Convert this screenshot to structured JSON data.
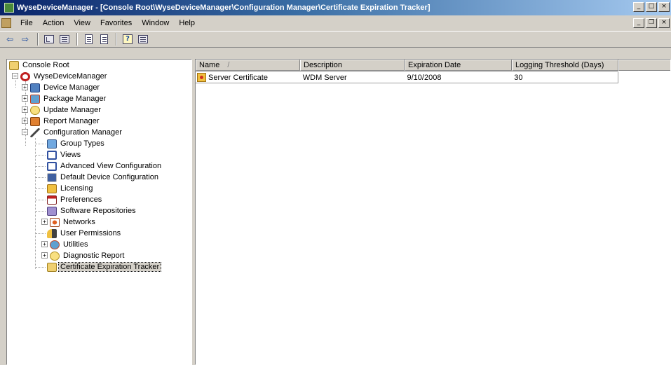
{
  "window": {
    "title": "WyseDeviceManager - [Console Root\\WyseDeviceManager\\Configuration Manager\\Certificate Expiration Tracker]",
    "icon": "wdm-app-icon",
    "controls": {
      "minimize": "_",
      "maximize": "□",
      "close": "×"
    }
  },
  "menubar": {
    "items": [
      "File",
      "Action",
      "View",
      "Favorites",
      "Window",
      "Help"
    ],
    "mdi_controls": {
      "minimize": "_",
      "restore": "❐",
      "close": "×"
    }
  },
  "toolbar": {
    "back": "⇦",
    "forward": "⇨",
    "buttons": [
      "up-one-level",
      "show-hide-tree",
      "list-view",
      "export-list",
      "help",
      "properties"
    ]
  },
  "tree": {
    "items": [
      {
        "label": "Console Root",
        "icon": "folder-icon"
      },
      {
        "label": "WyseDeviceManager",
        "icon": "wdm-icon"
      },
      {
        "label": "Device Manager",
        "icon": "devices-icon"
      },
      {
        "label": "Package Manager",
        "icon": "package-icon"
      },
      {
        "label": "Update Manager",
        "icon": "update-icon"
      },
      {
        "label": "Report Manager",
        "icon": "report-icon"
      },
      {
        "label": "Configuration Manager",
        "icon": "tools-icon"
      },
      {
        "label": "Group Types",
        "icon": "group-icon"
      },
      {
        "label": "Views",
        "icon": "views-icon"
      },
      {
        "label": "Advanced View Configuration",
        "icon": "views-icon"
      },
      {
        "label": "Default Device Configuration",
        "icon": "device-config-icon"
      },
      {
        "label": "Licensing",
        "icon": "license-icon"
      },
      {
        "label": "Preferences",
        "icon": "preferences-icon"
      },
      {
        "label": "Software Repositories",
        "icon": "repository-icon"
      },
      {
        "label": "Networks",
        "icon": "network-icon"
      },
      {
        "label": "User Permissions",
        "icon": "user-permissions-icon"
      },
      {
        "label": "Utilities",
        "icon": "utilities-icon"
      },
      {
        "label": "Diagnostic Report",
        "icon": "diagnostic-icon"
      },
      {
        "label": "Certificate Expiration Tracker",
        "icon": "certificate-tracker-icon",
        "selected": true
      }
    ]
  },
  "list": {
    "columns": [
      "Name",
      "Description",
      "Expiration Date",
      "Logging Threshold (Days)"
    ],
    "sort_indicator": "/",
    "rows": [
      {
        "name": "Server Certificate",
        "description": "WDM Server",
        "expiration_date": "9/10/2008",
        "logging_threshold": "30"
      }
    ]
  },
  "colors": {
    "titlebar_start": "#0a246a",
    "titlebar_end": "#a6caf0",
    "chrome": "#d4d0c8",
    "selected_node": "#d4d0c8"
  }
}
